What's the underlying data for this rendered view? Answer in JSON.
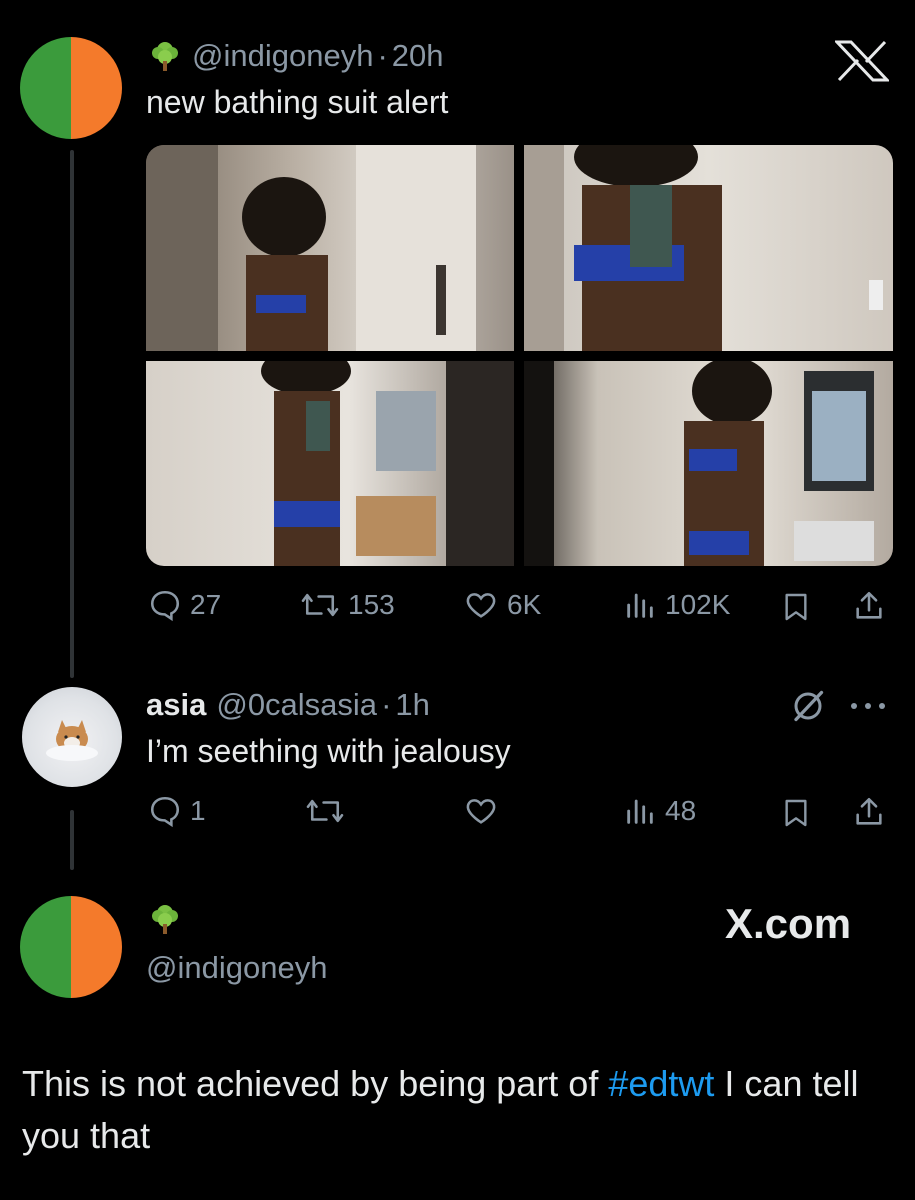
{
  "main_tweet": {
    "handle": "@indigoneyh",
    "separator": "·",
    "time": "20h",
    "text": "new bathing suit alert",
    "metrics": {
      "replies": "27",
      "retweets": "153",
      "likes": "6K",
      "views": "102K"
    }
  },
  "reply": {
    "name": "asia",
    "handle": "@0calsasia",
    "separator": "·",
    "time": "1h",
    "text": "I’m seething with jealousy",
    "metrics": {
      "replies": "1",
      "views": "48"
    }
  },
  "quote": {
    "handle": "@indigoneyh",
    "watermark": "X.com"
  },
  "caption": {
    "before": "This is not achieved by being part of ",
    "hashtag": "#edtwt",
    "after": " I can tell you that"
  },
  "colors": {
    "background": "#000000",
    "avatar_left": "#3b9b3c",
    "avatar_right": "#f47a2b",
    "muted": "#8b98a5",
    "link": "#1d9bf0"
  },
  "icons": [
    "tree-icon",
    "x-logo-icon",
    "reply-icon",
    "retweet-icon",
    "like-icon",
    "views-icon",
    "bookmark-icon",
    "share-icon",
    "grok-icon",
    "more-icon"
  ]
}
